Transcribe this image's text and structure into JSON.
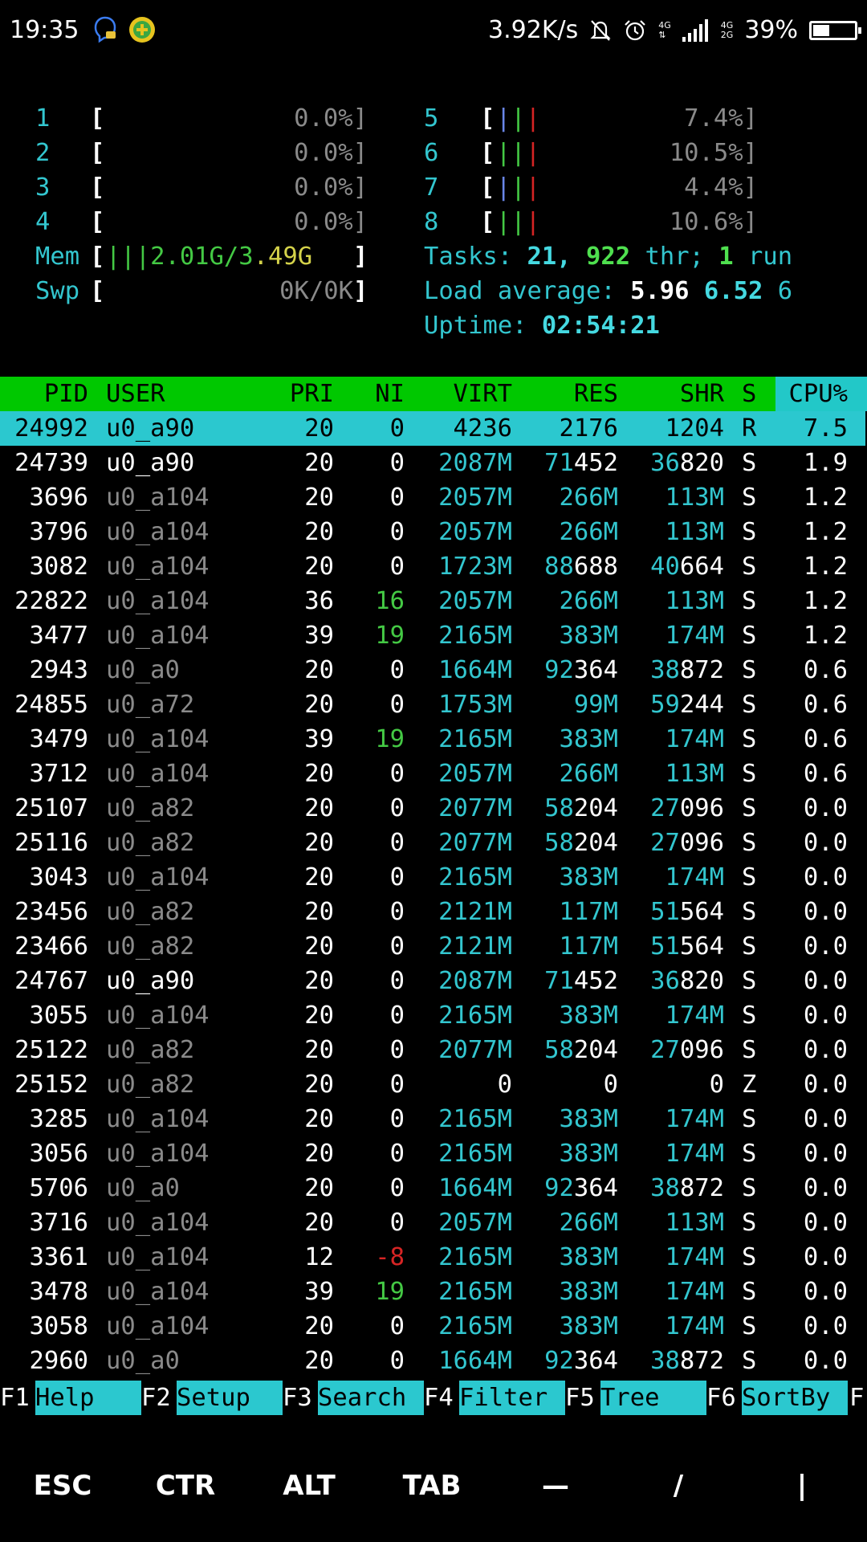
{
  "statusbar": {
    "time": "19:35",
    "left_icons": [
      "assistant-icon",
      "plus-badge-icon"
    ],
    "net_speed": "3.92K/s",
    "net_small_a": "4G",
    "net_small_b": "4G",
    "net_small_c": "2G",
    "battery_pct": "39%",
    "battery_level": 0.39
  },
  "meters": {
    "cpus": [
      {
        "id": "1",
        "pct": "0.0%]"
      },
      {
        "id": "2",
        "pct": "0.0%]"
      },
      {
        "id": "3",
        "pct": "0.0%]"
      },
      {
        "id": "4",
        "pct": "0.0%]"
      },
      {
        "id": "5",
        "pct": "7.4%]"
      },
      {
        "id": "6",
        "pct": "10.5%]"
      },
      {
        "id": "7",
        "pct": "4.4%]"
      },
      {
        "id": "8",
        "pct": "10.6%]"
      }
    ],
    "mem_label": "Mem",
    "mem_value_a": "2.01G/3",
    "mem_value_b": ".49G",
    "swp_label": "Swp",
    "swp_value": "0K/0K",
    "tasks_label": "Tasks: ",
    "tasks_count": "21",
    "tasks_sep": ", ",
    "threads": "922",
    "threads_label": " thr; ",
    "running": "1",
    "running_label": " run",
    "load_label": "Load average: ",
    "load1": "5.96",
    "load5": "6.52",
    "load15": "6",
    "uptime_label": "Uptime: ",
    "uptime": "02:54:21"
  },
  "columns": [
    "PID",
    "USER",
    "PRI",
    "NI",
    "VIRT",
    "RES",
    "SHR",
    "S",
    "CPU%"
  ],
  "processes": [
    {
      "pid": "24992",
      "user": "u0_a90",
      "pri": "20",
      "ni": "0",
      "virt": "4236",
      "res": "2176",
      "shr": "1204",
      "s": "R",
      "cpu": "7.5"
    },
    {
      "pid": "24739",
      "user": "u0_a90",
      "pri": "20",
      "ni": "0",
      "virt": "2087M",
      "res": "71452",
      "shr": "36820",
      "s": "S",
      "cpu": "1.9"
    },
    {
      "pid": "3696",
      "user": "u0_a104",
      "pri": "20",
      "ni": "0",
      "virt": "2057M",
      "res": "266M",
      "shr": "113M",
      "s": "S",
      "cpu": "1.2"
    },
    {
      "pid": "3796",
      "user": "u0_a104",
      "pri": "20",
      "ni": "0",
      "virt": "2057M",
      "res": "266M",
      "shr": "113M",
      "s": "S",
      "cpu": "1.2"
    },
    {
      "pid": "3082",
      "user": "u0_a104",
      "pri": "20",
      "ni": "0",
      "virt": "1723M",
      "res": "88688",
      "shr": "40664",
      "s": "S",
      "cpu": "1.2"
    },
    {
      "pid": "22822",
      "user": "u0_a104",
      "pri": "36",
      "ni": "16",
      "virt": "2057M",
      "res": "266M",
      "shr": "113M",
      "s": "S",
      "cpu": "1.2"
    },
    {
      "pid": "3477",
      "user": "u0_a104",
      "pri": "39",
      "ni": "19",
      "virt": "2165M",
      "res": "383M",
      "shr": "174M",
      "s": "S",
      "cpu": "1.2"
    },
    {
      "pid": "2943",
      "user": "u0_a0",
      "pri": "20",
      "ni": "0",
      "virt": "1664M",
      "res": "92364",
      "shr": "38872",
      "s": "S",
      "cpu": "0.6"
    },
    {
      "pid": "24855",
      "user": "u0_a72",
      "pri": "20",
      "ni": "0",
      "virt": "1753M",
      "res": "99M",
      "shr": "59244",
      "s": "S",
      "cpu": "0.6"
    },
    {
      "pid": "3479",
      "user": "u0_a104",
      "pri": "39",
      "ni": "19",
      "virt": "2165M",
      "res": "383M",
      "shr": "174M",
      "s": "S",
      "cpu": "0.6"
    },
    {
      "pid": "3712",
      "user": "u0_a104",
      "pri": "20",
      "ni": "0",
      "virt": "2057M",
      "res": "266M",
      "shr": "113M",
      "s": "S",
      "cpu": "0.6"
    },
    {
      "pid": "25107",
      "user": "u0_a82",
      "pri": "20",
      "ni": "0",
      "virt": "2077M",
      "res": "58204",
      "shr": "27096",
      "s": "S",
      "cpu": "0.0"
    },
    {
      "pid": "25116",
      "user": "u0_a82",
      "pri": "20",
      "ni": "0",
      "virt": "2077M",
      "res": "58204",
      "shr": "27096",
      "s": "S",
      "cpu": "0.0"
    },
    {
      "pid": "3043",
      "user": "u0_a104",
      "pri": "20",
      "ni": "0",
      "virt": "2165M",
      "res": "383M",
      "shr": "174M",
      "s": "S",
      "cpu": "0.0"
    },
    {
      "pid": "23456",
      "user": "u0_a82",
      "pri": "20",
      "ni": "0",
      "virt": "2121M",
      "res": "117M",
      "shr": "51564",
      "s": "S",
      "cpu": "0.0"
    },
    {
      "pid": "23466",
      "user": "u0_a82",
      "pri": "20",
      "ni": "0",
      "virt": "2121M",
      "res": "117M",
      "shr": "51564",
      "s": "S",
      "cpu": "0.0"
    },
    {
      "pid": "24767",
      "user": "u0_a90",
      "pri": "20",
      "ni": "0",
      "virt": "2087M",
      "res": "71452",
      "shr": "36820",
      "s": "S",
      "cpu": "0.0"
    },
    {
      "pid": "3055",
      "user": "u0_a104",
      "pri": "20",
      "ni": "0",
      "virt": "2165M",
      "res": "383M",
      "shr": "174M",
      "s": "S",
      "cpu": "0.0"
    },
    {
      "pid": "25122",
      "user": "u0_a82",
      "pri": "20",
      "ni": "0",
      "virt": "2077M",
      "res": "58204",
      "shr": "27096",
      "s": "S",
      "cpu": "0.0"
    },
    {
      "pid": "25152",
      "user": "u0_a82",
      "pri": "20",
      "ni": "0",
      "virt": "0",
      "res": "0",
      "shr": "0",
      "s": "Z",
      "cpu": "0.0"
    },
    {
      "pid": "3285",
      "user": "u0_a104",
      "pri": "20",
      "ni": "0",
      "virt": "2165M",
      "res": "383M",
      "shr": "174M",
      "s": "S",
      "cpu": "0.0"
    },
    {
      "pid": "3056",
      "user": "u0_a104",
      "pri": "20",
      "ni": "0",
      "virt": "2165M",
      "res": "383M",
      "shr": "174M",
      "s": "S",
      "cpu": "0.0"
    },
    {
      "pid": "5706",
      "user": "u0_a0",
      "pri": "20",
      "ni": "0",
      "virt": "1664M",
      "res": "92364",
      "shr": "38872",
      "s": "S",
      "cpu": "0.0"
    },
    {
      "pid": "3716",
      "user": "u0_a104",
      "pri": "20",
      "ni": "0",
      "virt": "2057M",
      "res": "266M",
      "shr": "113M",
      "s": "S",
      "cpu": "0.0"
    },
    {
      "pid": "3361",
      "user": "u0_a104",
      "pri": "12",
      "ni": "-8",
      "virt": "2165M",
      "res": "383M",
      "shr": "174M",
      "s": "S",
      "cpu": "0.0"
    },
    {
      "pid": "3478",
      "user": "u0_a104",
      "pri": "39",
      "ni": "19",
      "virt": "2165M",
      "res": "383M",
      "shr": "174M",
      "s": "S",
      "cpu": "0.0"
    },
    {
      "pid": "3058",
      "user": "u0_a104",
      "pri": "20",
      "ni": "0",
      "virt": "2165M",
      "res": "383M",
      "shr": "174M",
      "s": "S",
      "cpu": "0.0"
    },
    {
      "pid": "2960",
      "user": "u0_a0",
      "pri": "20",
      "ni": "0",
      "virt": "1664M",
      "res": "92364",
      "shr": "38872",
      "s": "S",
      "cpu": "0.0"
    }
  ],
  "function_keys": [
    {
      "key": "F1",
      "label": "Help  "
    },
    {
      "key": "F2",
      "label": "Setup "
    },
    {
      "key": "F3",
      "label": "Search"
    },
    {
      "key": "F4",
      "label": "Filter"
    },
    {
      "key": "F5",
      "label": "Tree  "
    },
    {
      "key": "F6",
      "label": "SortBy"
    },
    {
      "key": "F",
      "label": ""
    }
  ],
  "extra_keys": [
    "ESC",
    "CTR",
    "ALT",
    "TAB",
    "—",
    "/",
    "|"
  ],
  "colors": {
    "header_green": "#00c800",
    "cyan": "#2bc8cf",
    "green": "#44c944",
    "red": "#d62424",
    "gray_user": "#8a8a8a"
  }
}
